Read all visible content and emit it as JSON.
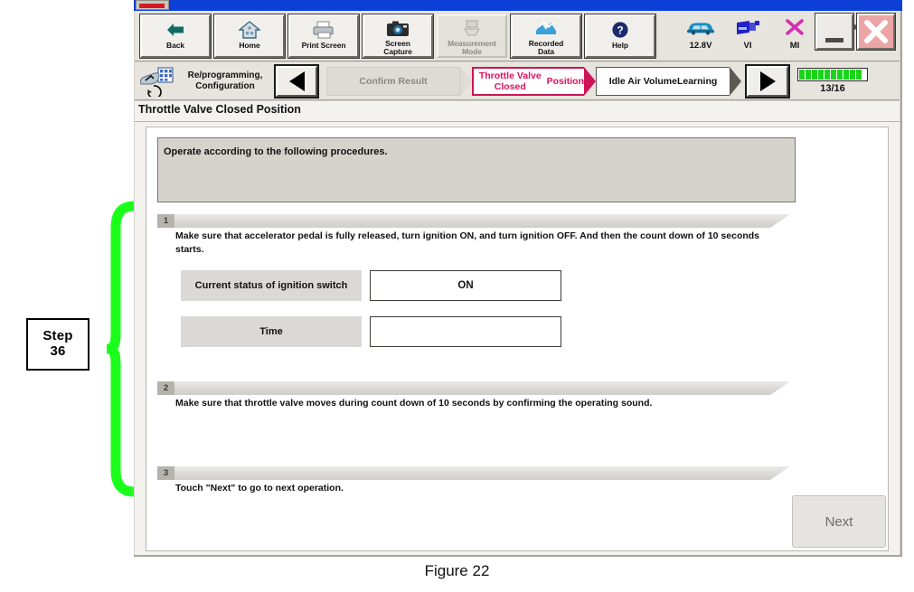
{
  "annotation": {
    "callout_line1": "Step",
    "callout_line2": "36"
  },
  "caption": "Figure 22",
  "toolbar": {
    "buttons": [
      {
        "label": "Back",
        "icon": "back-arrow-icon",
        "disabled": false
      },
      {
        "label": "Home",
        "icon": "home-icon",
        "disabled": false
      },
      {
        "label": "Print Screen",
        "icon": "printer-icon",
        "disabled": false
      },
      {
        "label": "Screen\nCapture",
        "icon": "camera-icon",
        "disabled": false
      },
      {
        "label": "Measurement\nMode",
        "icon": "measurement-icon",
        "disabled": true
      },
      {
        "label": "Recorded\nData",
        "icon": "recorded-data-icon",
        "disabled": false
      },
      {
        "label": "Help",
        "icon": "help-question-icon",
        "disabled": false
      }
    ],
    "status": [
      {
        "label": "12.8V",
        "icon": "car-icon"
      },
      {
        "label": "VI",
        "icon": "vehicle-interface-icon"
      },
      {
        "label": "MI",
        "icon": "mi-cross-icon"
      },
      {
        "label": "",
        "icon": "battery-icon"
      }
    ],
    "window_buttons": [
      {
        "name": "minimize-button",
        "icon": "minimize-icon"
      },
      {
        "name": "close-button",
        "icon": "close-x-icon"
      }
    ]
  },
  "flowbar": {
    "mode_title": "Re/programming,\nConfiguration",
    "prev_button": "previous-step-button",
    "next_button": "next-step-button",
    "steps": [
      {
        "label": "Confirm Result",
        "state": "done"
      },
      {
        "label": "Throttle Valve Closed\nPosition",
        "state": "current"
      },
      {
        "label": "Idle Air Volume\nLearning",
        "state": "next"
      }
    ],
    "progress_text": "13/16",
    "progress_segments": 10,
    "progress_color": "#19d419",
    "current_color": "#e0115f"
  },
  "screen": {
    "page_title": "Throttle Valve Closed Position",
    "notice": "Operate according to the following procedures.",
    "steps": [
      {
        "number": "1",
        "text": "Make sure that accelerator pedal is fully released, turn ignition ON, and turn ignition OFF. And then the count down of 10 seconds starts."
      },
      {
        "number": "2",
        "text": "Make sure that throttle valve moves during count down of 10 seconds by confirming the operating sound."
      },
      {
        "number": "3",
        "text": "Touch \"Next\" to go to next operation."
      }
    ],
    "data_rows": [
      {
        "key": "Current status of ignition switch",
        "value": "ON"
      },
      {
        "key": "Time",
        "value": ""
      }
    ],
    "next_button_label": "Next"
  }
}
